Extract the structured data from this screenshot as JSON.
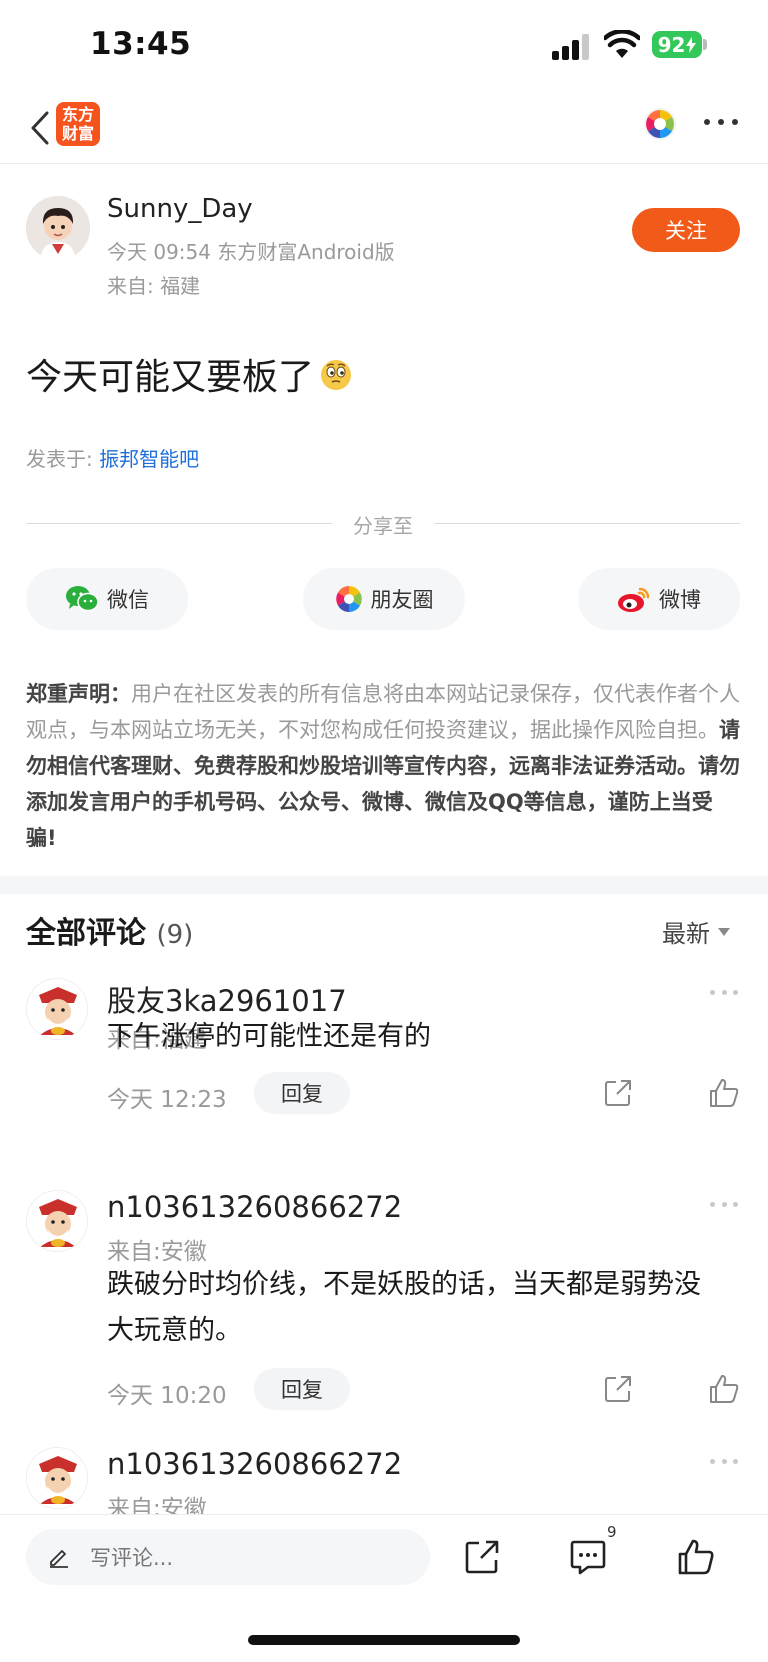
{
  "status_bar": {
    "time": "13:45",
    "battery": "92"
  },
  "nav": {
    "logo_text_top": "东方",
    "logo_text_bottom": "财富"
  },
  "author": {
    "name": "Sunny_Day",
    "meta": "今天 09:54 东方财富Android版",
    "location": "来自: 福建",
    "follow_label": "关注"
  },
  "post": {
    "title": "今天可能又要板了",
    "posted_in_label": "发表于:",
    "forum_name": "振邦智能吧"
  },
  "share": {
    "divider_label": "分享至",
    "wechat": "微信",
    "moments": "朋友圈",
    "weibo": "微博"
  },
  "disclaimer": {
    "heading": "郑重声明：",
    "normal_text": "用户在社区发表的所有信息将由本网站记录保存，仅代表作者个人观点，与本网站立场无关，不对您构成任何投资建议，据此操作风险自担。",
    "bold_text": "请勿相信代客理财、免费荐股和炒股培训等宣传内容，远离非法证券活动。请勿添加发言用户的手机号码、公众号、微博、微信及QQ等信息，谨防上当受骗!"
  },
  "comments": {
    "header": "全部评论",
    "count": "(9)",
    "sort_label": "最新",
    "items": [
      {
        "name": "股友3ka2961017",
        "location": "来自:福建",
        "text": "下午涨停的可能性还是有的",
        "time": "今天 12:23",
        "reply_label": "回复"
      },
      {
        "name": "n103613260866272",
        "location": "来自:安徽",
        "text": "跌破分时均价线，不是妖股的话，当天都是弱势没大玩意的。",
        "time": "今天 10:20",
        "reply_label": "回复"
      },
      {
        "name": "n103613260866272",
        "location": "来自:安徽"
      }
    ]
  },
  "bottom_bar": {
    "placeholder": "写评论...",
    "comment_badge": "9"
  },
  "colors": {
    "accent": "#f25a1a",
    "link": "#1e6fd9",
    "muted": "#9a9a9a",
    "wechat": "#2aae3c",
    "weibo": "#e6162d"
  }
}
